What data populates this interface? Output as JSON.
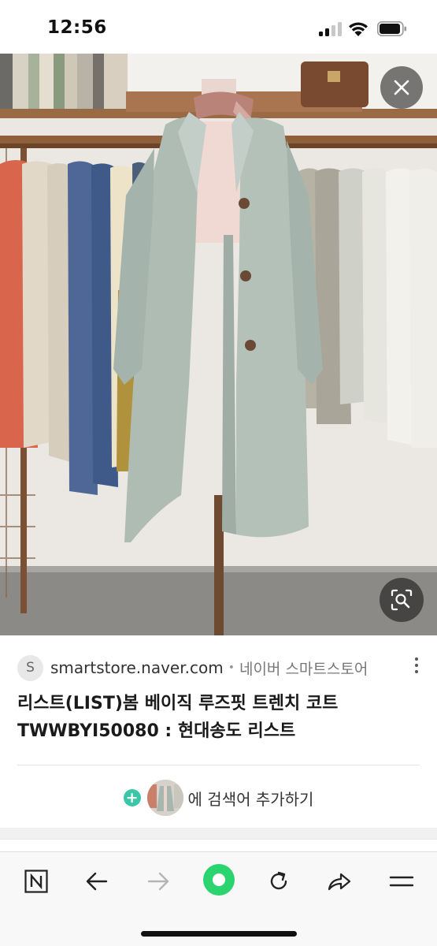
{
  "status": {
    "time": "12:56"
  },
  "photo": {
    "description_icon": "coat-photo"
  },
  "result": {
    "source_initial": "S",
    "source_domain": "smartstore.naver.com",
    "source_separator": "•",
    "source_name": "네이버 스마트스토어",
    "title": "리스트(LIST)봄 베이직 루즈핏 트렌치 코트 TWWBYI50080 : 현대송도 리스트"
  },
  "add_search": {
    "label": "에 검색어 추가하기",
    "plus": "+"
  },
  "toolbar": {
    "items": [
      "naver-home",
      "back",
      "forward",
      "green-home",
      "reload",
      "share",
      "menu"
    ],
    "accent": "#2bd46f"
  }
}
